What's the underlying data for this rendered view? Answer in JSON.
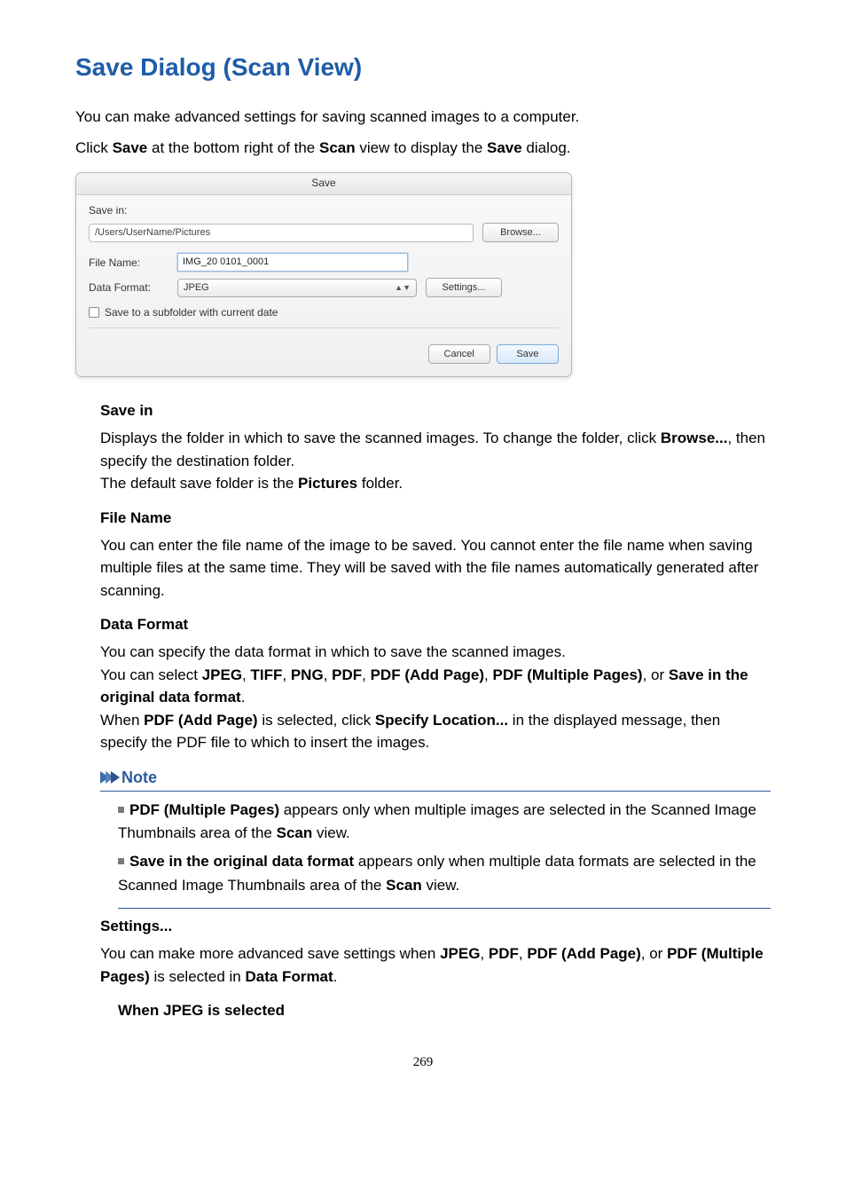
{
  "page": {
    "title": "Save Dialog (Scan View)",
    "intro_line1": "You can make advanced settings for saving scanned images to a computer.",
    "intro_line2_a": "Click ",
    "intro_line2_b": "Save",
    "intro_line2_c": " at the bottom right of the ",
    "intro_line2_d": "Scan",
    "intro_line2_e": " view to display the ",
    "intro_line2_f": "Save",
    "intro_line2_g": " dialog.",
    "page_number": "269"
  },
  "dialog": {
    "title": "Save",
    "save_in_label": "Save in:",
    "path_value": "/Users/UserName/Pictures",
    "browse_btn": "Browse...",
    "file_name_label": "File Name:",
    "file_name_value": "IMG_20    0101_0001",
    "data_format_label": "Data Format:",
    "data_format_value": "JPEG",
    "settings_btn": "Settings...",
    "subfolder_label": "Save to a subfolder with current date",
    "cancel_btn": "Cancel",
    "save_btn": "Save"
  },
  "terms": {
    "savein_h": "Save in",
    "savein_t1": "Displays the folder in which to save the scanned images. To change the folder, click ",
    "savein_b1": "Browse...",
    "savein_t2": ", then specify the destination folder.",
    "savein_t3a": "The default save folder is the ",
    "savein_b2": "Pictures",
    "savein_t3b": " folder.",
    "filename_h": "File Name",
    "filename_t": "You can enter the file name of the image to be saved. You cannot enter the file name when saving multiple files at the same time. They will be saved with the file names automatically generated after scanning.",
    "dataformat_h": "Data Format",
    "df_t1": "You can specify the data format in which to save the scanned images.",
    "df_t2a": "You can select ",
    "df_jpeg": "JPEG",
    "df_c": ", ",
    "df_tiff": "TIFF",
    "df_png": "PNG",
    "df_pdf": "PDF",
    "df_pdfadd": "PDF (Add Page)",
    "df_pdfmulti": "PDF (Multiple Pages)",
    "df_t2b": ", or ",
    "df_saveorig": "Save in the original data format",
    "df_t2c": ".",
    "df_t3a": "When ",
    "df_t3b": " is selected, click ",
    "df_specloc": "Specify Location...",
    "df_t3c": " in the displayed message, then specify the PDF file to which to insert the images.",
    "note_label": "Note",
    "note1a": "PDF (Multiple Pages)",
    "note1b": " appears only when multiple images are selected in the Scanned Image Thumbnails area of the ",
    "note_scan": "Scan",
    "note1c": " view.",
    "note2a": "Save in the original data format",
    "note2b": " appears only when multiple data formats are selected in the Scanned Image Thumbnails area of the ",
    "note2c": " view.",
    "settings_h": "Settings...",
    "settings_t1a": "You can make more advanced save settings when ",
    "settings_t1b": ", or ",
    "settings_t1c": " is selected in ",
    "settings_dflbl": "Data Format",
    "settings_t1d": ".",
    "when_jpeg": "When JPEG is selected"
  }
}
